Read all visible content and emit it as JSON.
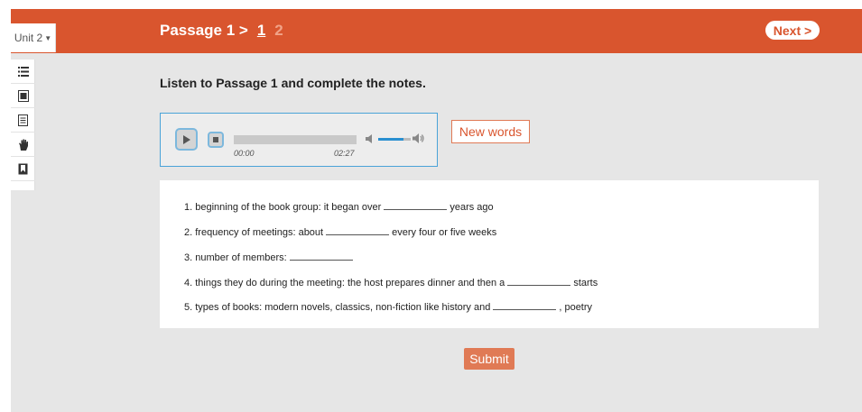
{
  "header": {
    "unit_label": "Unit 2",
    "passage_label": "Passage 1 >",
    "pages": [
      "1",
      "2"
    ],
    "next_label": "Next >"
  },
  "sidebar": {
    "tools": [
      {
        "icon": "list-icon"
      },
      {
        "icon": "dictionary-icon"
      },
      {
        "icon": "document-icon"
      },
      {
        "icon": "hand-icon"
      },
      {
        "icon": "bookmark-icon"
      }
    ]
  },
  "main": {
    "instruction": "Listen to Passage 1 and complete the notes.",
    "player": {
      "current_time": "00:00",
      "total_time": "02:27",
      "progress": 0,
      "volume": 0.78
    },
    "new_words_label": "New words",
    "notes": [
      {
        "before": "1. beginning of the book group: it began over",
        "after": "years ago"
      },
      {
        "before": "2. frequency of meetings: about",
        "after": "every four or five weeks"
      },
      {
        "before": "3. number of members:",
        "after": ""
      },
      {
        "before": "4. things they do during the meeting: the host prepares dinner and then a",
        "after": "starts"
      },
      {
        "before": "5. types of books: modern novels, classics, non-fiction like history and",
        "after": ", poetry"
      }
    ],
    "submit_label": "Submit"
  },
  "colors": {
    "brand": "#d9552e",
    "accent_blue": "#2a8fd0",
    "background": "#e6e6e6"
  }
}
